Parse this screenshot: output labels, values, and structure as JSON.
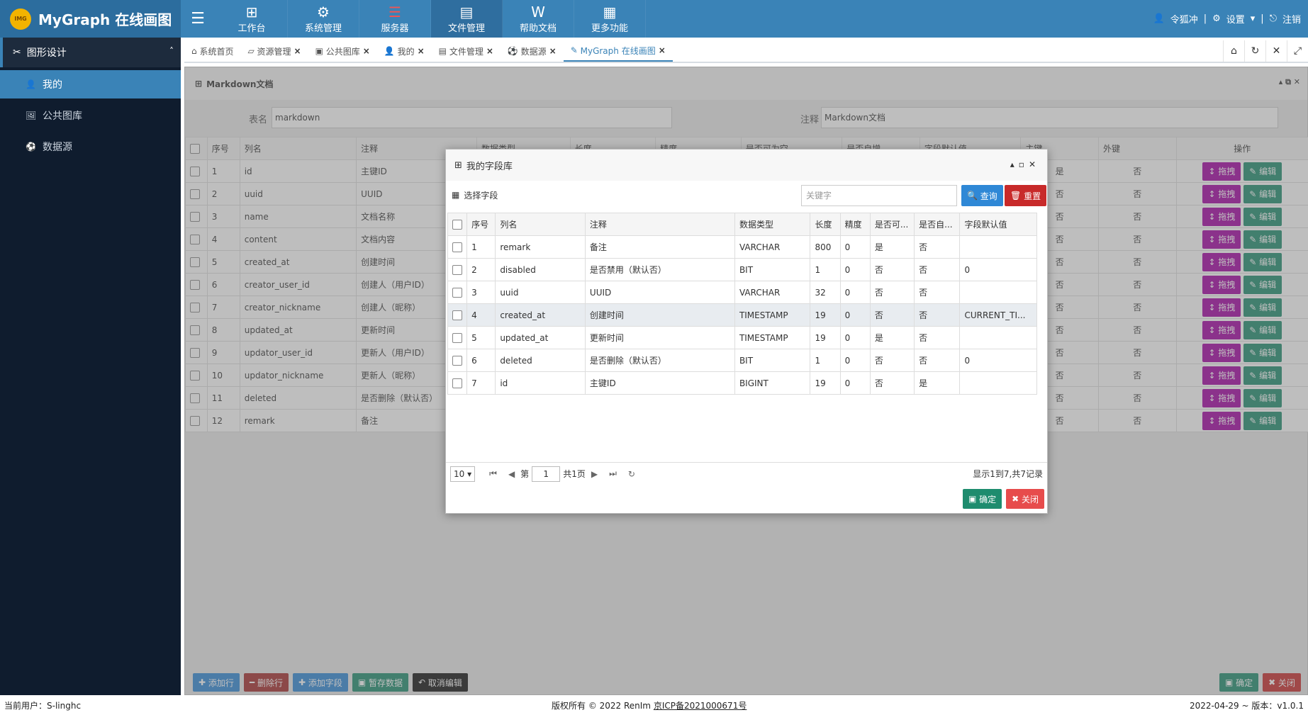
{
  "app": {
    "title": "MyGraph 在线画图",
    "logo_text": "IMG"
  },
  "topnav": [
    {
      "icon": "⊞",
      "label": "工作台"
    },
    {
      "icon": "⚙",
      "label": "系统管理"
    },
    {
      "icon": "☰",
      "label": "服务器"
    },
    {
      "icon": "▤",
      "label": "文件管理"
    },
    {
      "icon": "W",
      "label": "帮助文档"
    },
    {
      "icon": "▦",
      "label": "更多功能"
    }
  ],
  "topright": {
    "user": "令狐冲",
    "settings": "设置",
    "logout": "注销"
  },
  "sidebar": {
    "group": "图形设计",
    "items": [
      {
        "icon": "👤",
        "label": "我的"
      },
      {
        "icon": "🖼",
        "label": "公共图库"
      },
      {
        "icon": "⚽",
        "label": "数据源"
      }
    ]
  },
  "tabs": [
    {
      "label": "系统首页"
    },
    {
      "label": "资源管理"
    },
    {
      "label": "公共图库"
    },
    {
      "label": "我的"
    },
    {
      "label": "文件管理"
    },
    {
      "label": "数据源"
    },
    {
      "label": "MyGraph 在线画图"
    }
  ],
  "panel": {
    "title": "Markdown文档",
    "table_name_label": "表名",
    "table_name_value": "markdown",
    "comment_label": "注释",
    "comment_value": "Markdown文档"
  },
  "grid": {
    "headers": [
      "序号",
      "列名",
      "注释",
      "数据类型",
      "长度",
      "精度",
      "是否可为空",
      "是否自增",
      "字段默认值",
      "主键",
      "外键",
      "操作"
    ],
    "rows": [
      {
        "no": "1",
        "name": "id",
        "comment": "主键ID",
        "pk": "是",
        "fk": "否"
      },
      {
        "no": "2",
        "name": "uuid",
        "comment": "UUID",
        "pk": "否",
        "fk": "否"
      },
      {
        "no": "3",
        "name": "name",
        "comment": "文档名称",
        "pk": "否",
        "fk": "否"
      },
      {
        "no": "4",
        "name": "content",
        "comment": "文档内容",
        "pk": "否",
        "fk": "否"
      },
      {
        "no": "5",
        "name": "created_at",
        "comment": "创建时间",
        "pk": "否",
        "fk": "否"
      },
      {
        "no": "6",
        "name": "creator_user_id",
        "comment": "创建人（用户ID）",
        "pk": "否",
        "fk": "否"
      },
      {
        "no": "7",
        "name": "creator_nickname",
        "comment": "创建人（昵称）",
        "pk": "否",
        "fk": "否"
      },
      {
        "no": "8",
        "name": "updated_at",
        "comment": "更新时间",
        "pk": "否",
        "fk": "否"
      },
      {
        "no": "9",
        "name": "updator_user_id",
        "comment": "更新人（用户ID）",
        "pk": "否",
        "fk": "否"
      },
      {
        "no": "10",
        "name": "updator_nickname",
        "comment": "更新人（昵称）",
        "pk": "否",
        "fk": "否"
      },
      {
        "no": "11",
        "name": "deleted",
        "comment": "是否删除（默认否）",
        "pk": "否",
        "fk": "否"
      },
      {
        "no": "12",
        "name": "remark",
        "comment": "备注",
        "pk": "否",
        "fk": "否"
      }
    ],
    "drag_label": "拖拽",
    "edit_label": "编辑"
  },
  "bottombar": {
    "add_row": "添加行",
    "delete_row": "删除行",
    "add_field": "添加字段",
    "save_temp": "暂存数据",
    "cancel_edit": "取消编辑",
    "confirm": "确定",
    "close": "关闭"
  },
  "footer": {
    "user": "当前用户：S-linghc",
    "copyright": "版权所有 © 2022 RenIm ",
    "icp": "京ICP备2021000671号",
    "version": "2022-04-29 ~ 版本：v1.0.1"
  },
  "modal": {
    "title": "我的字段库",
    "toolbar_label": "选择字段",
    "search_placeholder": "关键字",
    "query": "查询",
    "reset": "重置",
    "headers": [
      "序号",
      "列名",
      "注释",
      "数据类型",
      "长度",
      "精度",
      "是否可...",
      "是否自...",
      "字段默认值"
    ],
    "rows": [
      {
        "no": "1",
        "name": "remark",
        "comment": "备注",
        "type": "VARCHAR",
        "len": "800",
        "prec": "0",
        "nullable": "是",
        "auto": "否",
        "def": ""
      },
      {
        "no": "2",
        "name": "disabled",
        "comment": "是否禁用（默认否）",
        "type": "BIT",
        "len": "1",
        "prec": "0",
        "nullable": "否",
        "auto": "否",
        "def": "0"
      },
      {
        "no": "3",
        "name": "uuid",
        "comment": "UUID",
        "type": "VARCHAR",
        "len": "32",
        "prec": "0",
        "nullable": "否",
        "auto": "否",
        "def": ""
      },
      {
        "no": "4",
        "name": "created_at",
        "comment": "创建时间",
        "type": "TIMESTAMP",
        "len": "19",
        "prec": "0",
        "nullable": "否",
        "auto": "否",
        "def": "CURRENT_TI..."
      },
      {
        "no": "5",
        "name": "updated_at",
        "comment": "更新时间",
        "type": "TIMESTAMP",
        "len": "19",
        "prec": "0",
        "nullable": "是",
        "auto": "否",
        "def": ""
      },
      {
        "no": "6",
        "name": "deleted",
        "comment": "是否删除（默认否）",
        "type": "BIT",
        "len": "1",
        "prec": "0",
        "nullable": "否",
        "auto": "否",
        "def": "0"
      },
      {
        "no": "7",
        "name": "id",
        "comment": "主键ID",
        "type": "BIGINT",
        "len": "19",
        "prec": "0",
        "nullable": "否",
        "auto": "是",
        "def": ""
      }
    ],
    "pager": {
      "size": "10",
      "page_prefix": "第",
      "page": "1",
      "page_total": "共1页",
      "info": "显示1到7,共7记录"
    },
    "confirm": "确定",
    "close": "关闭"
  }
}
